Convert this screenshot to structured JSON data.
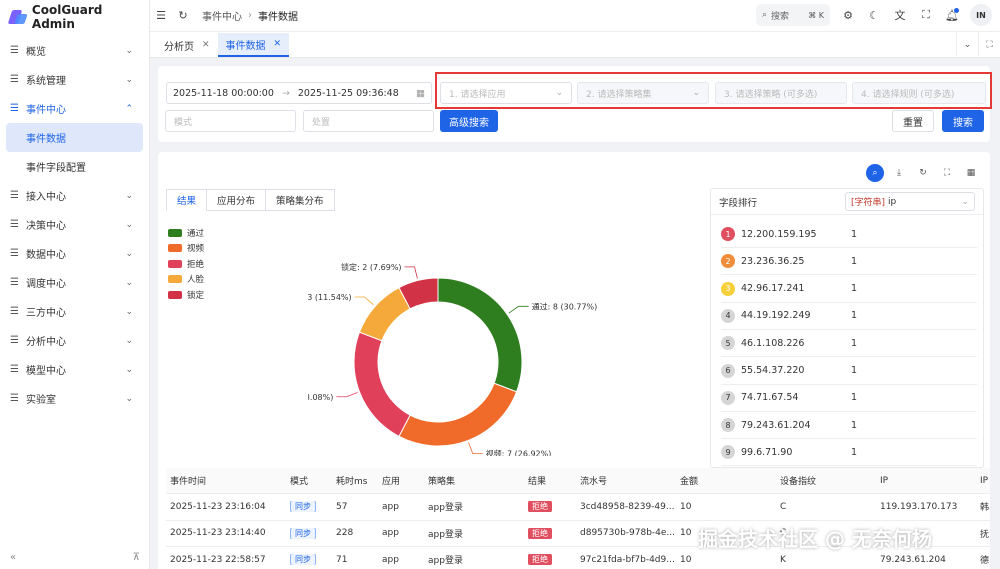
{
  "app": {
    "title": "CoolGuard Admin"
  },
  "sidebar": {
    "items": [
      {
        "label": "概览",
        "expanded": false
      },
      {
        "label": "系统管理",
        "expanded": false
      },
      {
        "label": "事件中心",
        "expanded": true,
        "children": [
          {
            "label": "事件数据",
            "active": true
          },
          {
            "label": "事件字段配置",
            "active": false
          }
        ]
      },
      {
        "label": "接入中心",
        "expanded": false
      },
      {
        "label": "决策中心",
        "expanded": false
      },
      {
        "label": "数据中心",
        "expanded": false
      },
      {
        "label": "调度中心",
        "expanded": false
      },
      {
        "label": "三方中心",
        "expanded": false
      },
      {
        "label": "分析中心",
        "expanded": false
      },
      {
        "label": "模型中心",
        "expanded": false
      },
      {
        "label": "实验室",
        "expanded": false
      }
    ]
  },
  "topbar": {
    "breadcrumb": [
      "事件中心",
      "事件数据"
    ],
    "search_label": "搜索",
    "search_shortcut": "⌘ K",
    "avatar_initials": "IN"
  },
  "tabs": [
    {
      "label": "分析页",
      "active": false
    },
    {
      "label": "事件数据",
      "active": true
    }
  ],
  "filters": {
    "date_start": "2025-11-18 00:00:00",
    "date_end": "2025-11-25 09:36:48",
    "app_placeholder": "1. 请选择应用",
    "policy_set_placeholder": "2. 请选择策略集",
    "policy_placeholder": "3. 请选择策略 (可多选)",
    "rule_placeholder": "4. 请选择规则 (可多选)",
    "mode_placeholder": "模式",
    "disposal_placeholder": "处置",
    "advanced_search": "高级搜索",
    "reset": "重置",
    "search": "搜索"
  },
  "chart_tabs": [
    {
      "label": "结果",
      "active": true
    },
    {
      "label": "应用分布",
      "active": false
    },
    {
      "label": "策略集分布",
      "active": false
    }
  ],
  "chart_data": {
    "type": "pie",
    "donut": true,
    "categories": [
      "通过",
      "视频",
      "拒绝",
      "人脸",
      "锁定"
    ],
    "values": [
      8,
      7,
      6,
      3,
      2
    ],
    "percents": [
      "30.77%",
      "26.92%",
      "23.08%",
      "11.54%",
      "7.69%"
    ],
    "colors": [
      "#2e7d1f",
      "#f06a2a",
      "#e0405a",
      "#f5a93a",
      "#d23245"
    ],
    "legend_position": "top-left"
  },
  "ranking": {
    "title": "字段排行",
    "field_tag": "[字符串]",
    "field_name": "ip",
    "rows": [
      {
        "rank": "1",
        "ip": "12.200.159.195",
        "count": "1",
        "color": "#e04f5f"
      },
      {
        "rank": "2",
        "ip": "23.236.36.25",
        "count": "1",
        "color": "#f08c3a"
      },
      {
        "rank": "3",
        "ip": "42.96.17.241",
        "count": "1",
        "color": "#f5d03a"
      },
      {
        "rank": "4",
        "ip": "44.19.192.249",
        "count": "1",
        "color": "#d5d5d5"
      },
      {
        "rank": "5",
        "ip": "46.1.108.226",
        "count": "1",
        "color": "#d5d5d5"
      },
      {
        "rank": "6",
        "ip": "55.54.37.220",
        "count": "1",
        "color": "#d5d5d5"
      },
      {
        "rank": "7",
        "ip": "74.71.67.54",
        "count": "1",
        "color": "#d5d5d5"
      },
      {
        "rank": "8",
        "ip": "79.243.61.204",
        "count": "1",
        "color": "#d5d5d5"
      },
      {
        "rank": "9",
        "ip": "99.6.71.90",
        "count": "1",
        "color": "#d5d5d5"
      }
    ]
  },
  "table": {
    "columns": [
      "事件时间",
      "模式",
      "耗时ms",
      "应用",
      "策略集",
      "结果",
      "流水号",
      "金额",
      "设备指纹",
      "IP",
      "IP"
    ],
    "rows": [
      [
        "2025-11-23 23:16:04",
        "同步",
        "57",
        "app",
        "app登录",
        "拒绝",
        "3cd48958-8239-49...",
        "10",
        "C",
        "119.193.170.173",
        "韩"
      ],
      [
        "2025-11-23 23:14:40",
        "同步",
        "228",
        "app",
        "app登录",
        "拒绝",
        "d895730b-978b-4e...",
        "10",
        "C",
        "",
        "抚"
      ],
      [
        "2025-11-23 22:58:57",
        "同步",
        "71",
        "app",
        "app登录",
        "拒绝",
        "97c21fda-bf7b-4d9...",
        "10",
        "K",
        "79.243.61.204",
        "德"
      ]
    ]
  },
  "watermark": "掘金技术社区 @ 无奈何杨"
}
